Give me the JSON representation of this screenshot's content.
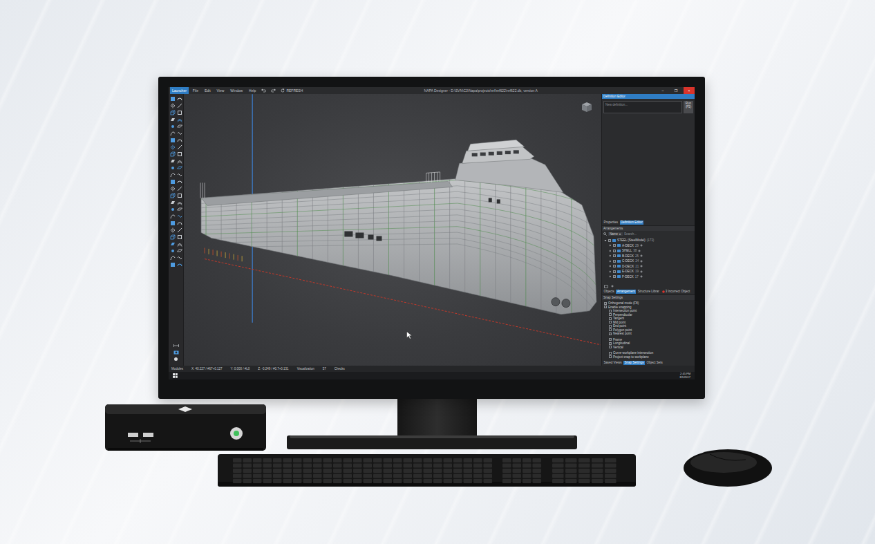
{
  "window": {
    "title": "NAPA Designer - D:\\SVN\\C3\\Napa\\projects\\ref\\ref622\\ref622.db, version A",
    "controls": [
      "–",
      "❐",
      "×"
    ]
  },
  "menu": [
    {
      "label": "Launcher",
      "selected": true
    },
    {
      "label": "File",
      "selected": false
    },
    {
      "label": "Edit",
      "selected": false
    },
    {
      "label": "View",
      "selected": false
    },
    {
      "label": "Window",
      "selected": false
    },
    {
      "label": "Help",
      "selected": false
    }
  ],
  "refresh": "REFRESH",
  "definition_editor": {
    "title": "Definition Editor",
    "placeholder": "New definition...",
    "run": "Run (F5)"
  },
  "panel_tabs": [
    {
      "label": "Properties",
      "selected": false
    },
    {
      "label": "Definition Editor",
      "selected": true
    }
  ],
  "arrangements": {
    "title": "Arrangements",
    "field": "Name",
    "placeholder": "Search...",
    "root": {
      "label": "STEEL (SteelModel)",
      "count": "(173)",
      "checked": true,
      "expanded": true
    },
    "items": [
      {
        "label": "A-DECK",
        "count": "29",
        "checked": true
      },
      {
        "label": "SHELL",
        "count": "38",
        "checked": true
      },
      {
        "label": "B-DECK",
        "count": "25",
        "checked": true
      },
      {
        "label": "C-DECK",
        "count": "24",
        "checked": true
      },
      {
        "label": "D-DECK",
        "count": "21",
        "checked": true
      },
      {
        "label": "E-DECK",
        "count": "19",
        "checked": true
      },
      {
        "label": "F-DECK",
        "count": "17",
        "checked": true
      }
    ]
  },
  "object_tabs": [
    {
      "label": "Objects",
      "selected": false,
      "alert": false
    },
    {
      "label": "Arrangement",
      "selected": true,
      "alert": false
    },
    {
      "label": "Structure Librar",
      "selected": false,
      "alert": false
    },
    {
      "label": "3 Incorrect Object",
      "selected": false,
      "alert": true
    }
  ],
  "snap": {
    "title": "Snap Settings",
    "groups": [
      [
        {
          "label": "Orthogonal mode (F8)",
          "checked": true,
          "kind": "main"
        },
        {
          "label": "Enable snapping",
          "checked": true,
          "kind": "main"
        },
        {
          "label": "Intersection point",
          "checked": false,
          "kind": "sub"
        },
        {
          "label": "Perpendicular",
          "checked": false,
          "kind": "sub"
        },
        {
          "label": "Tangent",
          "checked": false,
          "kind": "sub"
        },
        {
          "label": "Mid point",
          "checked": false,
          "kind": "sub"
        },
        {
          "label": "End point",
          "checked": false,
          "kind": "sub"
        },
        {
          "label": "Polygon point",
          "checked": false,
          "kind": "sub"
        },
        {
          "label": "Nearest point",
          "checked": true,
          "kind": "sub"
        }
      ],
      [
        {
          "label": "Frame",
          "checked": true,
          "kind": "sub"
        },
        {
          "label": "Longitudinal",
          "checked": true,
          "kind": "sub"
        },
        {
          "label": "Vertical",
          "checked": false,
          "kind": "sub"
        }
      ],
      [
        {
          "label": "Curve-workplane intersection",
          "checked": false,
          "kind": "sub"
        },
        {
          "label": "Project snap to workplane",
          "checked": false,
          "kind": "sub"
        }
      ]
    ]
  },
  "bottom_tabs": [
    {
      "label": "Saved Views",
      "selected": false
    },
    {
      "label": "Snap Settings",
      "selected": true
    },
    {
      "label": "Object Sets",
      "selected": false
    }
  ],
  "status": {
    "modules": "Modules",
    "x": "X: 40.227 / #67+0.127",
    "y": "Y: 0.000 / #L0",
    "z": "Z: -0.249 / #0.7+0.131",
    "visualization": "Visualization",
    "level": "57",
    "checks": "Checks"
  },
  "taskbar": {
    "time": "2:45 PM",
    "date": "8/1/2017"
  }
}
